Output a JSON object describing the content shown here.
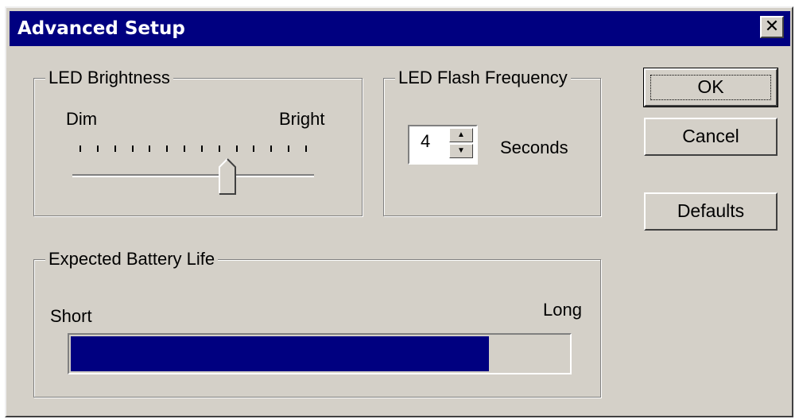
{
  "window": {
    "title": "Advanced Setup",
    "close_glyph": "✕"
  },
  "brightness": {
    "legend": "LED Brightness",
    "min_label": "Dim",
    "max_label": "Bright",
    "tick_count": 14,
    "value_fraction": 0.64
  },
  "flash": {
    "legend": "LED Flash Frequency",
    "value": "4",
    "unit_label": "Seconds",
    "up_glyph": "▲",
    "down_glyph": "▼"
  },
  "battery": {
    "legend": "Expected Battery Life",
    "min_label": "Short",
    "max_label": "Long",
    "level_fraction": 0.84,
    "fill_color": "#000080"
  },
  "buttons": {
    "ok": "OK",
    "cancel": "Cancel",
    "defaults": "Defaults"
  },
  "colors": {
    "face": "#d4d0c8",
    "titlebar": "#000080"
  }
}
